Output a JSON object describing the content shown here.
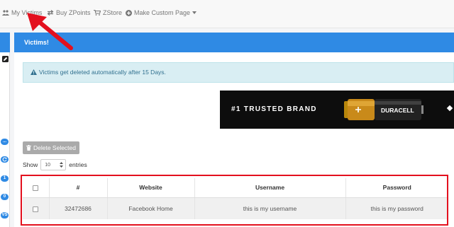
{
  "nav": {
    "my_victims": "My Victims",
    "buy_zpoints": "Buy ZPoints",
    "zstore": "ZStore",
    "make_custom_page": "Make Custom Page"
  },
  "sidebar": {
    "badges": [
      "...",
      "",
      "1",
      "0",
      "VS"
    ]
  },
  "panel": {
    "title": "Victims!"
  },
  "alert": {
    "text": "Victims get deleted automatically after 15 Days."
  },
  "ad": {
    "text": "#1 TRUSTED BRAND",
    "brand": "DURACELL"
  },
  "delete_button": "Delete Selected",
  "length": {
    "show": "Show",
    "value": "10",
    "entries": "entries"
  },
  "table": {
    "headers": [
      "",
      "#",
      "Website",
      "Username",
      "Password"
    ],
    "rows": [
      {
        "id": "32472686",
        "website": "Facebook Home",
        "username": "this is my username",
        "password": "this is my password"
      }
    ]
  },
  "colors": {
    "primary": "#2f8ae4",
    "alert_bg": "#d9eef3",
    "highlight": "#e3101e"
  }
}
